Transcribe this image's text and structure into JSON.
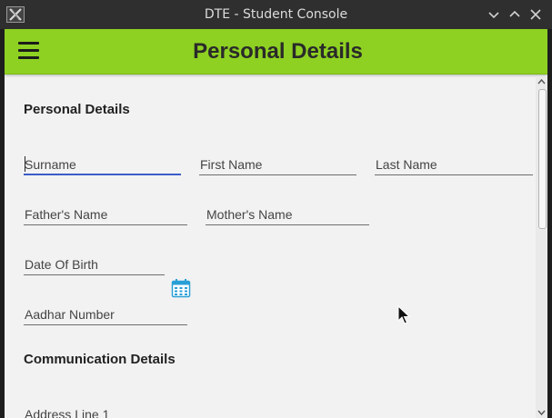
{
  "window": {
    "title": "DTE - Student Console",
    "app_icon": "x-app-icon",
    "controls": [
      "minimize-icon",
      "maximize-icon",
      "close-icon"
    ]
  },
  "header": {
    "title": "Personal Details",
    "menu_icon": "hamburger-menu-icon",
    "accent_color": "#8ed122"
  },
  "form": {
    "personal_section": "Personal Details",
    "surname": {
      "placeholder": "Surname",
      "value": ""
    },
    "first_name": {
      "placeholder": "First Name",
      "value": ""
    },
    "last_name": {
      "placeholder": "Last Name",
      "value": ""
    },
    "fathers_name": {
      "placeholder": "Father's Name",
      "value": ""
    },
    "mothers_name": {
      "placeholder": "Mother's Name",
      "value": ""
    },
    "date_of_birth": {
      "placeholder": "Date Of Birth",
      "value": "",
      "picker_icon": "calendar-icon"
    },
    "aadhar_number": {
      "placeholder": "Aadhar Number",
      "value": ""
    },
    "communication_section": "Communication Details",
    "address_line_1": {
      "placeholder": "Address Line 1",
      "value": ""
    }
  },
  "colors": {
    "focus_underline": "#3c5cc8",
    "calendar_icon": "#2a9fd6"
  }
}
